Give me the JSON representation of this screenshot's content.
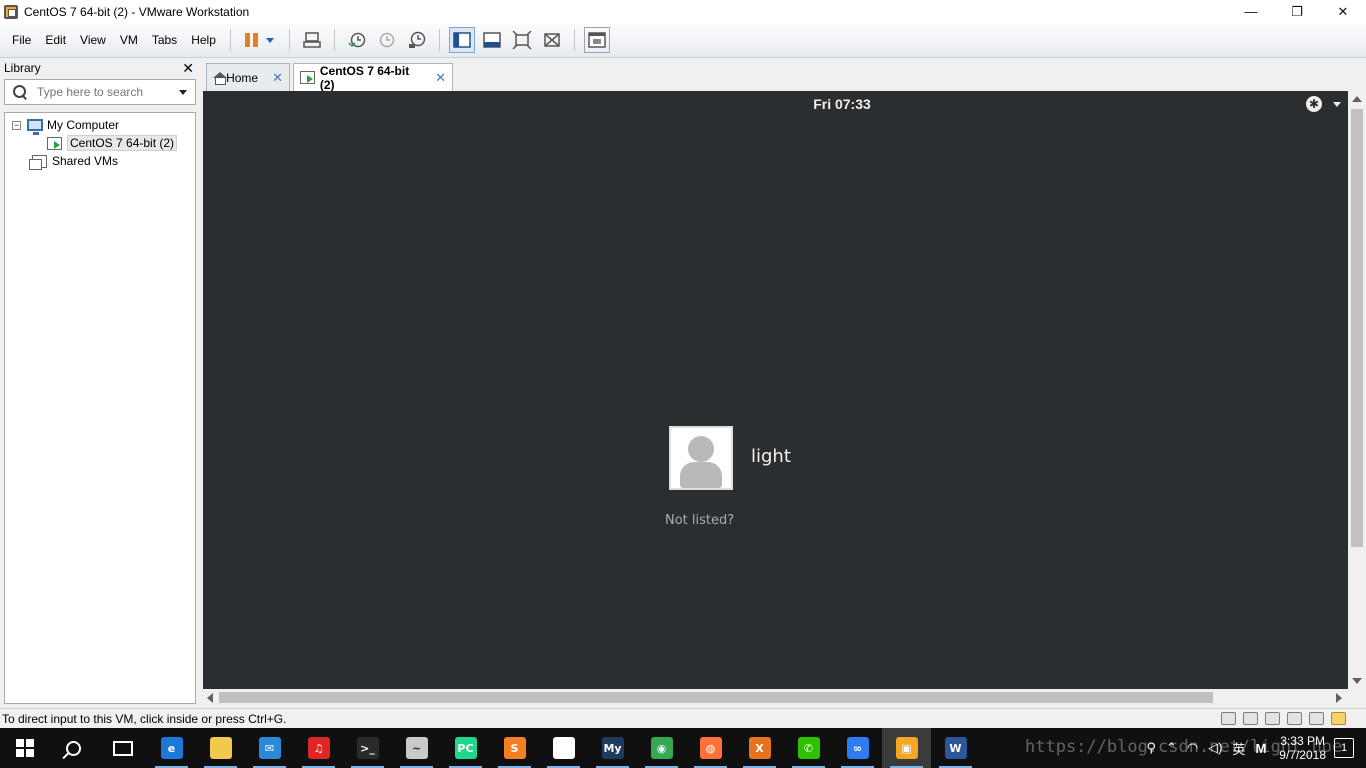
{
  "window": {
    "title": "CentOS 7 64-bit (2) - VMware Workstation",
    "minimize_glyph": "—",
    "maximize_glyph": "❐",
    "close_glyph": "✕"
  },
  "menu": {
    "items": [
      "File",
      "Edit",
      "View",
      "VM",
      "Tabs",
      "Help"
    ]
  },
  "toolbar": {
    "icons": [
      "pause-icon",
      "send-ctrl-alt-del-icon",
      "snapshot-take-icon",
      "snapshot-revert-icon",
      "snapshot-manager-icon",
      "library-view-icon",
      "thumbnail-bar-icon",
      "full-screen-icon",
      "unity-icon",
      "console-view-icon"
    ]
  },
  "library": {
    "title": "Library",
    "close_glyph": "✕",
    "search_placeholder": "Type here to search",
    "tree": {
      "expander_glyph": "−",
      "my_computer": "My Computer",
      "vm": "CentOS 7 64-bit (2)",
      "shared": "Shared VMs"
    }
  },
  "tabs": [
    {
      "label": "Home",
      "close": "✕"
    },
    {
      "label": "CentOS 7 64-bit (2)",
      "close": "✕"
    }
  ],
  "vm_screen": {
    "clock": "Fri 07:33",
    "accessibility_glyph": "✱",
    "username": "light",
    "not_listed": "Not listed?",
    "background": "#2b2e30"
  },
  "status_bar": {
    "message": "To direct input to this VM, click inside or press Ctrl+G."
  },
  "taskbar": {
    "apps": [
      {
        "name": "edge-icon",
        "color": "#1e78d6",
        "letter": "e"
      },
      {
        "name": "file-explorer-icon",
        "color": "#f2c94c",
        "letter": ""
      },
      {
        "name": "mail-icon",
        "color": "#2b8ad8",
        "letter": "✉"
      },
      {
        "name": "netease-music-icon",
        "color": "#e02525",
        "letter": "♫"
      },
      {
        "name": "command-prompt-icon",
        "color": "#2a2a2a",
        "letter": ">_"
      },
      {
        "name": "wireshark-icon",
        "color": "#c9c9c9",
        "letter": "~"
      },
      {
        "name": "pycharm-icon",
        "color": "#21d789",
        "letter": "PC"
      },
      {
        "name": "sublime-text-icon",
        "color": "#f48024",
        "letter": "S"
      },
      {
        "name": "sticky-notes-icon",
        "color": "#ffffff",
        "letter": ""
      },
      {
        "name": "mysql-icon",
        "color": "#1e3a5f",
        "letter": "My"
      },
      {
        "name": "chrome-icon",
        "color": "#34a853",
        "letter": "◉"
      },
      {
        "name": "firefox-icon",
        "color": "#ff7139",
        "letter": "◍"
      },
      {
        "name": "xshell-icon",
        "color": "#e8731e",
        "letter": "X"
      },
      {
        "name": "wechat-icon",
        "color": "#2dc100",
        "letter": "✆"
      },
      {
        "name": "baidu-netdisk-icon",
        "color": "#2f7bf0",
        "letter": "∞"
      },
      {
        "name": "vmware-icon",
        "color": "#f5a623",
        "letter": "▣"
      },
      {
        "name": "word-icon",
        "color": "#2b579a",
        "letter": "W"
      }
    ],
    "tray": {
      "network_glyph": "⌃",
      "ime": "英",
      "clock_time": "3:33 PM",
      "clock_date": "9/7/2018",
      "notification_count": "1"
    },
    "watermark": "https://blog.csdn.net/light_hoe"
  }
}
